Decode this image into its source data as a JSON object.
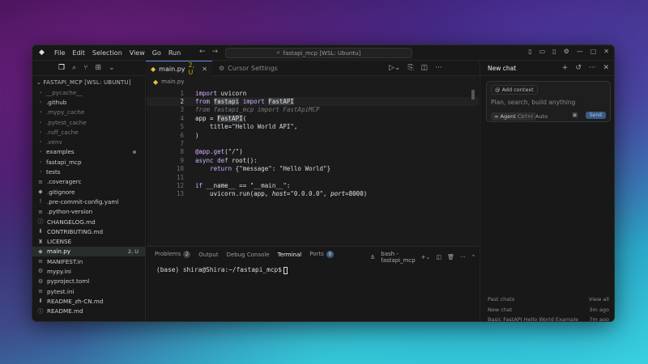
{
  "titlebar": {
    "menu": [
      "File",
      "Edit",
      "Selection",
      "View",
      "Go",
      "Run"
    ],
    "search": "fastapi_mcp [WSL: Ubuntu]"
  },
  "tabs": {
    "active": {
      "label": "main.py",
      "status": "2, U"
    },
    "inactive": {
      "label": "Cursor Settings"
    }
  },
  "sidebar": {
    "title": "FASTAPI_MCP [WSL: UBUNTU]",
    "items": [
      {
        "label": "__pycache__",
        "type": "folder",
        "dim": true
      },
      {
        "label": ".github",
        "type": "folder",
        "dim": false
      },
      {
        "label": ".mypy_cache",
        "type": "folder",
        "dim": true
      },
      {
        "label": ".pytest_cache",
        "type": "folder",
        "dim": true
      },
      {
        "label": ".ruff_cache",
        "type": "folder",
        "dim": true
      },
      {
        "label": ".venv",
        "type": "folder",
        "dim": true
      },
      {
        "label": "examples",
        "type": "folder",
        "dim": false,
        "dot": true
      },
      {
        "label": "fastapi_mcp",
        "type": "folder",
        "dim": false
      },
      {
        "label": "tests",
        "type": "folder",
        "dim": false
      },
      {
        "label": ".coveragerc",
        "type": "file",
        "icon": "≡"
      },
      {
        "label": ".gitignore",
        "type": "file",
        "icon": "◆"
      },
      {
        "label": ".pre-commit-config.yaml",
        "type": "file",
        "icon": "!"
      },
      {
        "label": ".python-version",
        "type": "file",
        "icon": "≡"
      },
      {
        "label": "CHANGELOG.md",
        "type": "file",
        "icon": "ⓘ"
      },
      {
        "label": "CONTRIBUTING.md",
        "type": "file",
        "icon": "⬇"
      },
      {
        "label": "LICENSE",
        "type": "file",
        "icon": "♜"
      },
      {
        "label": "main.py",
        "type": "file",
        "icon": "◆",
        "selected": true,
        "badge": "2, U"
      },
      {
        "label": "MANIFEST.in",
        "type": "file",
        "icon": "≡"
      },
      {
        "label": "mypy.ini",
        "type": "file",
        "icon": "⚙"
      },
      {
        "label": "pyproject.toml",
        "type": "file",
        "icon": "⚙"
      },
      {
        "label": "pytest.ini",
        "type": "file",
        "icon": "≡"
      },
      {
        "label": "README_zh-CN.md",
        "type": "file",
        "icon": "⬇"
      },
      {
        "label": "README.md",
        "type": "file",
        "icon": "ⓘ"
      }
    ]
  },
  "editor": {
    "breadcrumb": "main.py",
    "lines": [
      {
        "n": "1",
        "html": "<span class='kw'>import</span> <span class='nm'>uvicorn</span>"
      },
      {
        "n": "2",
        "cur": true,
        "html": "<span class='kw'>from</span> <span class='nm hl'>fastapi</span> <span class='kw'>import</span> <span class='nm hl'>FastAPI</span>"
      },
      {
        "n": "3",
        "html": "<span class='com'>from fastapi_mcp import FastApiMCP</span>"
      },
      {
        "n": "4",
        "html": "<span class='nm'>app = </span><span class='nm hl'>FastAPI</span><span class='nm'>(</span>"
      },
      {
        "n": "5",
        "html": "<span class='nm'>&nbsp;&nbsp;&nbsp;&nbsp;title=</span><span class='str'>\"Hello World API\"</span><span class='nm'>,</span>"
      },
      {
        "n": "6",
        "html": "<span class='nm'>)</span>"
      },
      {
        "n": "7",
        "html": ""
      },
      {
        "n": "8",
        "html": "<span class='dec'>@app.get</span><span class='nm'>(</span><span class='str'>\"/\"</span><span class='nm'>)</span>"
      },
      {
        "n": "9",
        "html": "<span class='kw'>async def</span> <span class='nm'>root():</span>"
      },
      {
        "n": "10",
        "html": "<span class='nm'>&nbsp;&nbsp;&nbsp;&nbsp;</span><span class='kw'>return</span> <span class='nm'>{</span><span class='str'>\"message\"</span><span class='nm'>: </span><span class='str'>\"Hello World\"</span><span class='nm'>}</span>"
      },
      {
        "n": "11",
        "html": ""
      },
      {
        "n": "12",
        "html": "<span class='kw'>if</span> <span class='nm'>__name__ == </span><span class='str'>\"__main__\"</span><span class='nm'>:</span>"
      },
      {
        "n": "13",
        "html": "<span class='nm'>&nbsp;&nbsp;&nbsp;&nbsp;uvicorn.run(app, </span><i class='nm'>host</i><span class='nm'>=</span><span class='str'>\"0.0.0.0\"</span><span class='nm'>, </span><i class='nm'>port</i><span class='nm'>=8000)</span>"
      }
    ]
  },
  "panel": {
    "tabs": {
      "problems": "Problems",
      "problems_count": "2",
      "output": "Output",
      "debug": "Debug Console",
      "terminal": "Terminal",
      "ports": "Ports",
      "ports_count": "9"
    },
    "shell": "bash - fastapi_mcp",
    "prompt": "(base) shira@Shira:~/fastapi_mcp$"
  },
  "chat": {
    "title": "New chat",
    "add_context": "Add context",
    "placeholder": "Plan, search, build anything",
    "mode": "Agent",
    "mode_shortcut": "Ctrl+I",
    "model": "Auto",
    "send": "Send",
    "past_label": "Past chats",
    "view_all": "View all",
    "history": [
      {
        "title": "New chat",
        "time": "3m ago"
      },
      {
        "title": "Basic FastAPI Hello World Example",
        "time": "7m ago"
      }
    ]
  }
}
